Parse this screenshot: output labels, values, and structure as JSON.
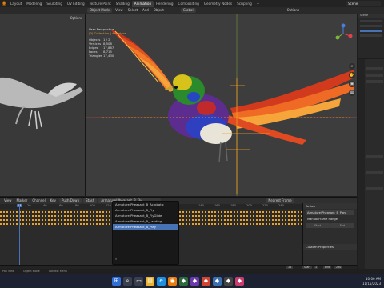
{
  "workspace_tabs": [
    "Layout",
    "Modeling",
    "Sculpting",
    "UV Editing",
    "Texture Paint",
    "Shading",
    "Animation",
    "Rendering",
    "Compositing",
    "Geometry Nodes",
    "Scripting",
    "+"
  ],
  "active_tab": "Animation",
  "scene": {
    "label": "Scene"
  },
  "viewport_header": {
    "editor": "Object Mode",
    "view": "View",
    "select": "Select",
    "add": "Add",
    "object": "Object",
    "shading": "Global",
    "options": "Options"
  },
  "left_view": {
    "options": "Options"
  },
  "viewport": {
    "perspective": "User Perspective",
    "collection": "(0) Collection | Armature",
    "stats": [
      {
        "key": "Objects",
        "value": "1 / 2"
      },
      {
        "key": "Vertices",
        "value": "8,508"
      },
      {
        "key": "Edges",
        "value": "17,887"
      },
      {
        "key": "Faces",
        "value": "8,715"
      },
      {
        "key": "Triangles",
        "value": "17,430"
      }
    ]
  },
  "timeline": {
    "menu": [
      "Marker",
      "Channel",
      "Key"
    ],
    "push_down": "Push Down",
    "stash": "Stash",
    "action_name": "Armature|Pheasant_B_Fly",
    "nearest_frame": "Nearest Frame",
    "current_frame": "14",
    "frame_ticks": [
      "20",
      "40",
      "60",
      "80",
      "100",
      "120",
      "140",
      "160",
      "180",
      "200",
      "220",
      "240"
    ],
    "start": "Start",
    "start_value": "1",
    "end": "End",
    "end_value": "250"
  },
  "action_list": {
    "items": [
      "Armature|Pheasant_B_Acrobatic",
      "Armature|Pheasant_B_Fly",
      "Armature|Pheasant_B_FlyGlide",
      "Armature|Pheasant_B_Landing",
      "Armature|Pheasant_B_Play"
    ],
    "selected_index": 4
  },
  "action_panel": {
    "section": "Action",
    "action_field": "Armature|Pheasant_B_Play",
    "manual_range": "Manual Frame Range",
    "start_label": "Start",
    "end_label": "End",
    "custom_props": "Custom Properties"
  },
  "status": {
    "left": "Pan View",
    "mid": "Object Mode",
    "right": "Context Menu"
  },
  "taskbar": {
    "date": "11/15/2023",
    "time": "10:06 AM"
  },
  "colors": {
    "accent": "#4772b3",
    "blender_orange": "#e87d0d",
    "bone": "#f5a01c"
  }
}
